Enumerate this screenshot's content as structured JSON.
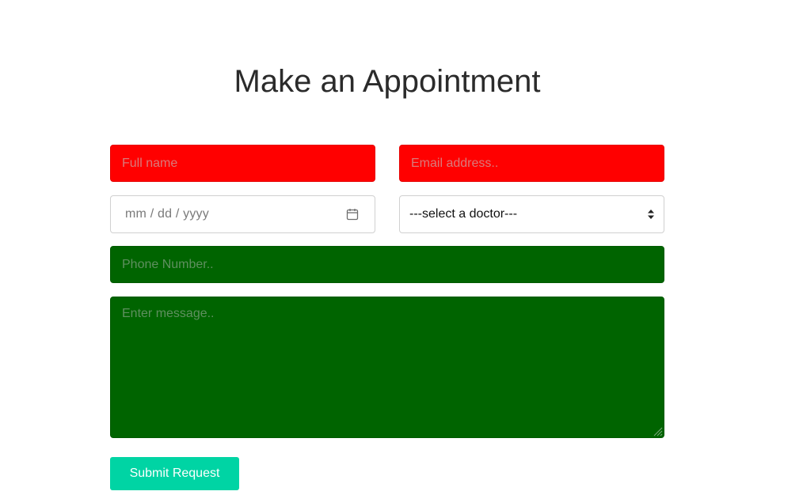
{
  "page": {
    "title": "Make an Appointment"
  },
  "form": {
    "full_name": {
      "placeholder": "Full name",
      "value": ""
    },
    "email": {
      "placeholder": "Email address..",
      "value": ""
    },
    "date": {
      "placeholder": "mm / dd / yyyy",
      "icon": "calendar-icon"
    },
    "doctor": {
      "selected": "---select a doctor---",
      "icon": "select-arrows-icon"
    },
    "phone": {
      "placeholder": "Phone Number..",
      "value": ""
    },
    "message": {
      "placeholder": "Enter message..",
      "value": ""
    },
    "submit_label": "Submit Request"
  },
  "colors": {
    "name_email_bg": "#ff0000",
    "phone_message_bg": "#006400",
    "submit_bg": "#00d4a4",
    "title_text": "#2b2b2b"
  }
}
